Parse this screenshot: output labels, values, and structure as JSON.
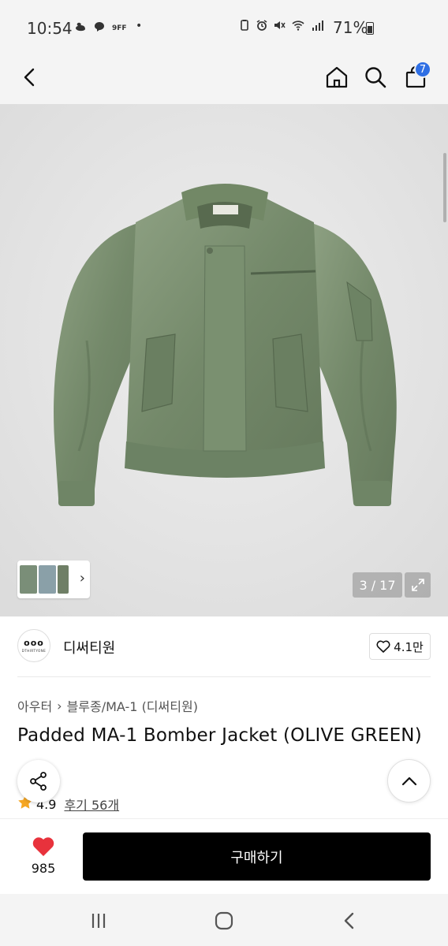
{
  "status_bar": {
    "time": "10:54",
    "dot": "•",
    "battery": "71%"
  },
  "header": {
    "cart_count": "7"
  },
  "gallery": {
    "counter": "3 / 17"
  },
  "brand": {
    "logo_mark": "ooo",
    "logo_sub": "DTHIRTYONE",
    "name": "디써티원",
    "likes": "4.1만"
  },
  "breadcrumb": {
    "items": [
      "아우터",
      "블루종/MA-1 (디써티원)"
    ],
    "separator": "›"
  },
  "product": {
    "title": "Padded MA-1 Bomber Jacket (OLIVE GREEN)",
    "rating": "4.9",
    "reviews": "후기 56개"
  },
  "bottom": {
    "wish_count": "985",
    "buy_label": "구매하기"
  },
  "colors": {
    "accent_badge": "#2f6fe4",
    "heart": "#e8323c",
    "star": "#f5a623",
    "jacket": "#7b9270"
  }
}
